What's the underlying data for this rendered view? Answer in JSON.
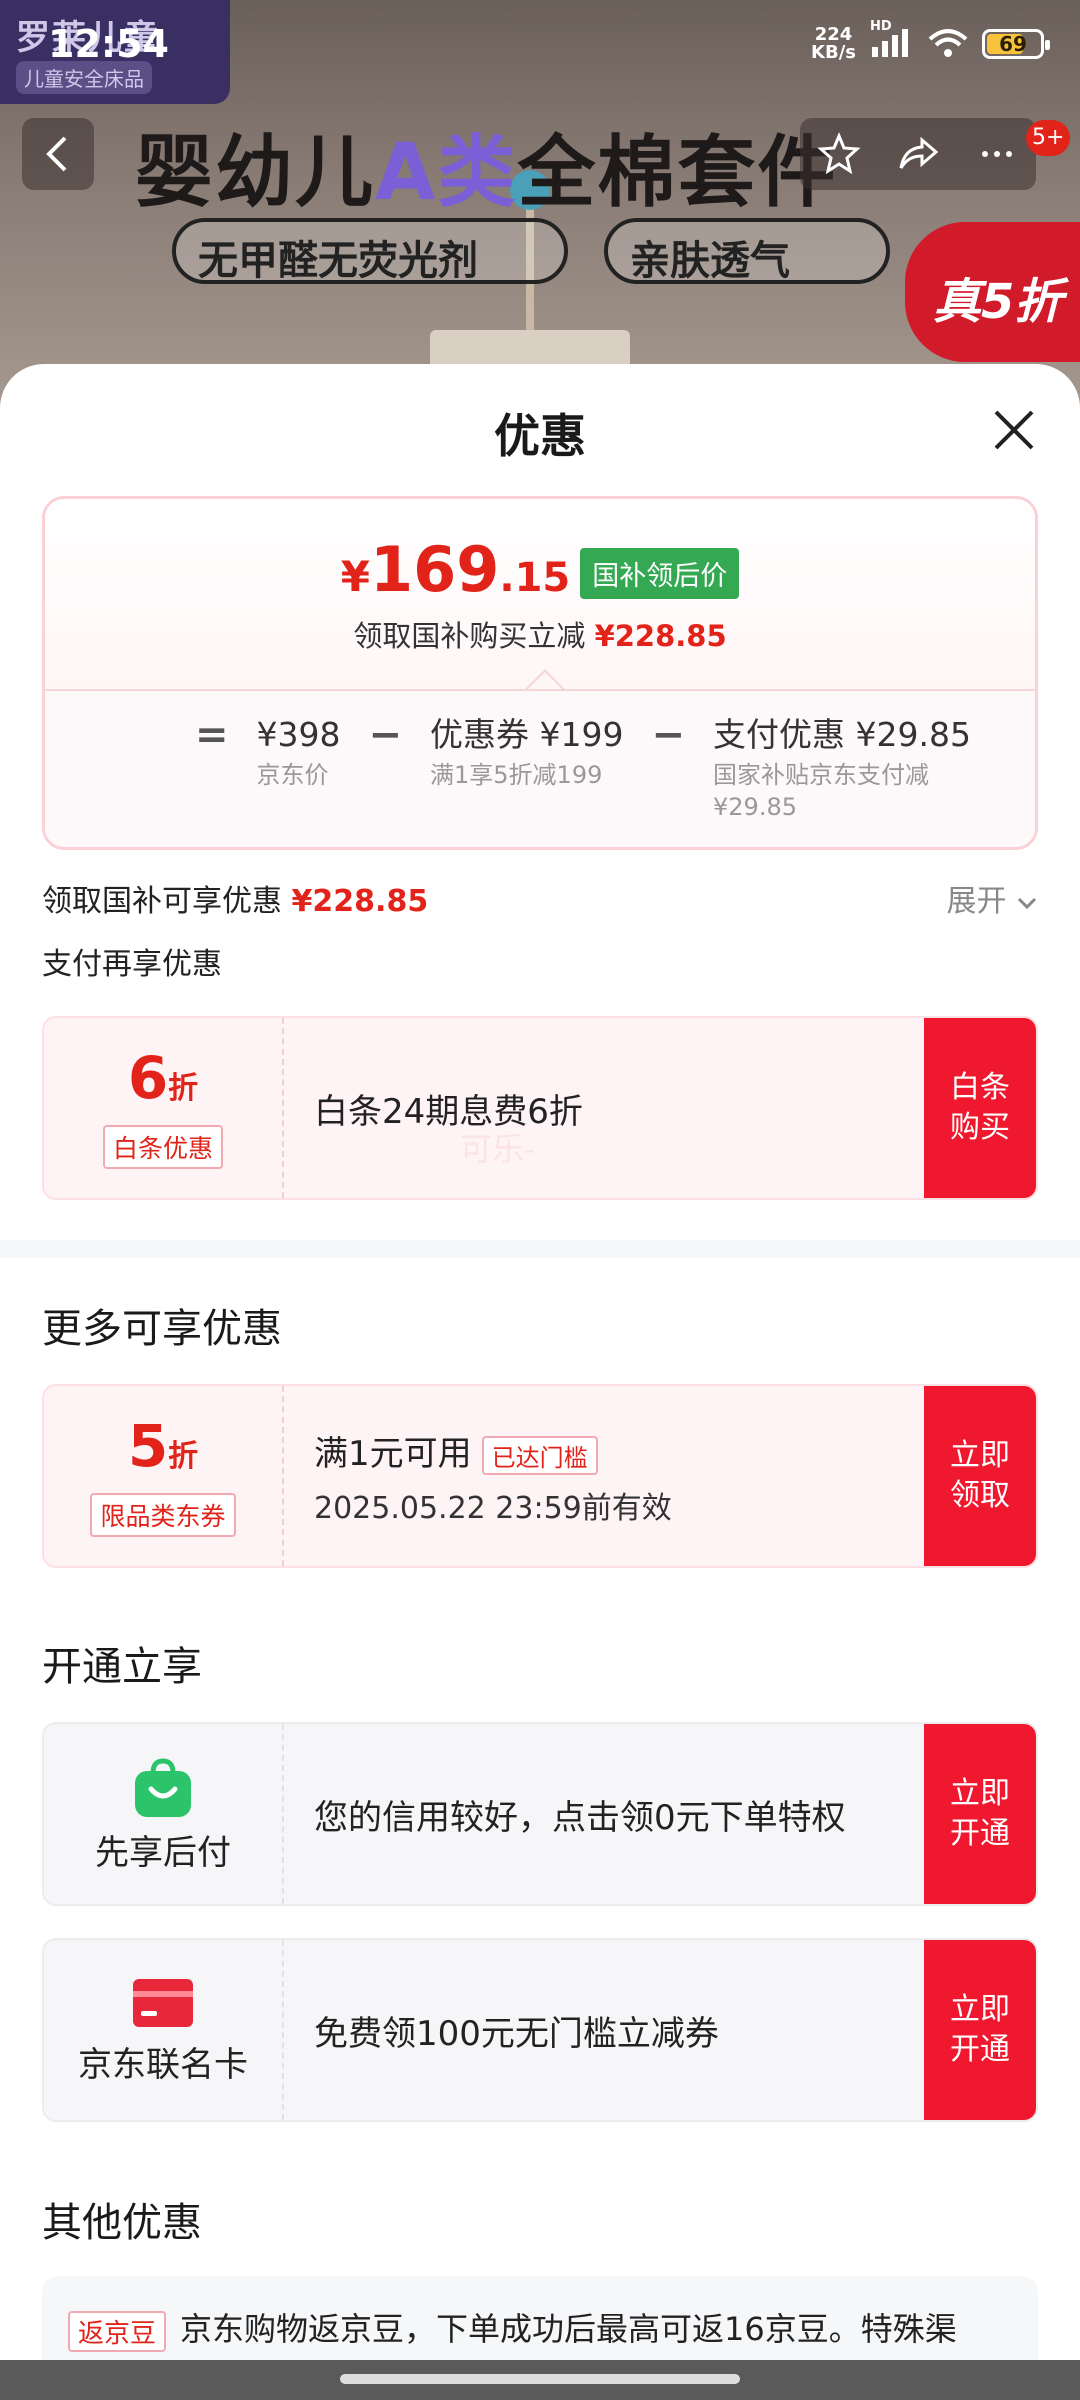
{
  "background": {
    "brand_line1": "罗莱儿童",
    "brand_line2": "儿童安全床品",
    "title_part1": "婴幼儿",
    "title_accent": "A类",
    "title_part2": "全棉套件",
    "pill1": "无甲醛无荧光剂",
    "pill2": "亲肤透气",
    "badge": "真5折",
    "cart_badge": "5+"
  },
  "status_bar": {
    "time": "12:54",
    "speed_value": "224",
    "speed_unit": "KB/s",
    "network": "HD",
    "battery_level": 69,
    "battery_text": "69"
  },
  "sheet": {
    "title": "优惠",
    "price": {
      "yen": "¥",
      "integer": "169",
      "decimal": ".15",
      "badge": "国补领后价",
      "sub_text": "领取国补购买立减",
      "sub_amount": "¥228.85"
    },
    "formula": {
      "equals": "=",
      "minus": "−",
      "items": [
        {
          "value": "¥398",
          "desc": "京东价"
        },
        {
          "value": "优惠券 ¥199",
          "desc": "满1享5折减199"
        },
        {
          "value": "支付优惠 ¥29.85",
          "desc": "国家补贴京东支付减",
          "desc2": "¥29.85"
        }
      ]
    },
    "enjoy_text": "领取国补可享优惠",
    "enjoy_amount": "¥228.85",
    "expand_label": "展开",
    "pay_title": "支付再享优惠",
    "baitiao": {
      "discount": "6",
      "unit": "折",
      "tag": "白条优惠",
      "text": "白条24期息费6折",
      "button_line1": "白条",
      "button_line2": "购买",
      "watermark": "可乐-"
    },
    "more_title": "更多可享优惠",
    "coupon": {
      "discount": "5",
      "unit": "折",
      "tag": "限品类东券",
      "condition": "满1元可用",
      "reached": "已达门槛",
      "expiry": "2025.05.22 23:59前有效",
      "button_line1": "立即",
      "button_line2": "领取"
    },
    "open_title": "开通立享",
    "paylater": {
      "label": "先享后付",
      "text": "您的信用较好，点击领0元下单特权",
      "button_line1": "立即",
      "button_line2": "开通",
      "icon_color": "#2bc46a"
    },
    "cobrand": {
      "label": "京东联名卡",
      "text": "免费领100元无门槛立减券",
      "button_line1": "立即",
      "button_line2": "开通",
      "icon_color": "#e8283a"
    },
    "other_title": "其他优惠",
    "other": {
      "tag": "返京豆",
      "text": "京东购物返京豆，下单成功后最高可返16京豆。特殊渠"
    }
  },
  "colors": {
    "accent_red": "#e2231a",
    "button_red": "#f0182e",
    "gov_green": "#34a853"
  }
}
